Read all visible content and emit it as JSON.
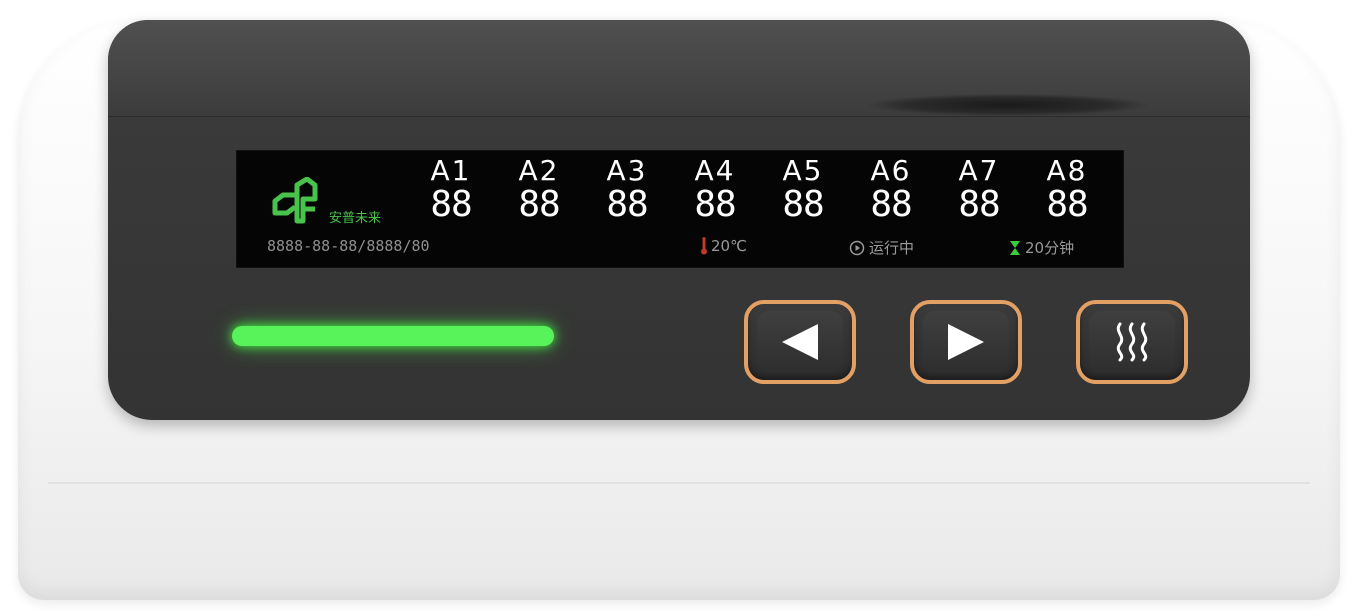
{
  "display": {
    "brand_text": "安普未来",
    "channels": [
      {
        "label": "A1",
        "value": "88"
      },
      {
        "label": "A2",
        "value": "88"
      },
      {
        "label": "A3",
        "value": "88"
      },
      {
        "label": "A4",
        "value": "88"
      },
      {
        "label": "A5",
        "value": "88"
      },
      {
        "label": "A6",
        "value": "88"
      },
      {
        "label": "A7",
        "value": "88"
      },
      {
        "label": "A8",
        "value": "88"
      }
    ],
    "datetime": "8888-88-88/8888/80",
    "temperature": "20℃",
    "status": "运行中",
    "timer": "20分钟"
  },
  "controls": {
    "prev_icon": "left-triangle-icon",
    "next_icon": "right-triangle-icon",
    "heat_icon": "heat-waves-icon"
  },
  "colors": {
    "accent_green": "#58f25a",
    "button_border": "#e3a065",
    "temp_red": "#c0392b",
    "timer_green": "#3ccc3c"
  }
}
